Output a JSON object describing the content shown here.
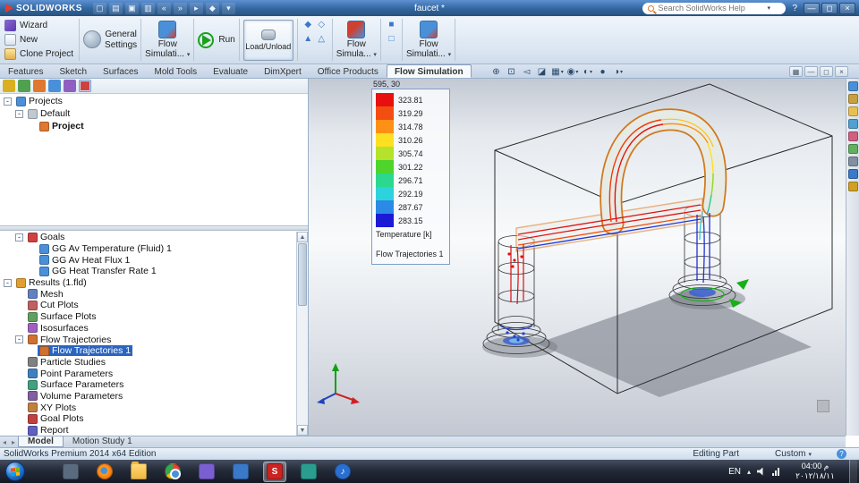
{
  "titlebar": {
    "app": "SOLIDWORKS",
    "doc": "faucet *",
    "search_placeholder": "Search SolidWorks Help",
    "help": "?",
    "quick_icons": [
      {
        "name": "new-file-icon",
        "glyph": "▢"
      },
      {
        "name": "open-file-icon",
        "glyph": "▤"
      },
      {
        "name": "save-icon",
        "glyph": "▣"
      },
      {
        "name": "print-icon",
        "glyph": "▥"
      },
      {
        "name": "undo-icon",
        "glyph": "«"
      },
      {
        "name": "redo-icon",
        "glyph": "»"
      },
      {
        "name": "select-icon",
        "glyph": "▸"
      },
      {
        "name": "rebuild-icon",
        "glyph": "◆"
      },
      {
        "name": "options-icon",
        "glyph": "▾"
      }
    ],
    "window_buttons": [
      {
        "name": "minimize-button",
        "glyph": "—"
      },
      {
        "name": "restore-button",
        "glyph": "◻"
      },
      {
        "name": "close-button",
        "glyph": "×",
        "close": true
      }
    ]
  },
  "ribbon": {
    "wizard": "Wizard",
    "new": "New",
    "clone_project": "Clone Project",
    "general_settings_1": "General",
    "general_settings_2": "Settings",
    "flow_btn1_1": "Flow",
    "flow_btn1_2": "Simulati...",
    "run": "Run",
    "load_unload": "Load/Unload",
    "flow_btn2_1": "Flow",
    "flow_btn2_2": "Simula...",
    "flow_btn3_1": "Flow",
    "flow_btn3_2": "Simulati...",
    "caret": "▾",
    "display_toggle_icons": [
      {
        "name": "flow-toggle-icon-1",
        "glyph": "◆"
      },
      {
        "name": "flow-toggle-icon-2",
        "glyph": "◇"
      },
      {
        "name": "flow-toggle-icon-3",
        "glyph": "▲"
      },
      {
        "name": "flow-toggle-icon-4",
        "glyph": "△"
      }
    ],
    "extra_toggle_icons": [
      {
        "name": "flow-toggle-icon-5",
        "glyph": "■"
      },
      {
        "name": "flow-toggle-icon-6",
        "glyph": "□"
      }
    ]
  },
  "tabs": {
    "items": [
      {
        "label": "Features"
      },
      {
        "label": "Sketch"
      },
      {
        "label": "Surfaces"
      },
      {
        "label": "Mold Tools"
      },
      {
        "label": "Evaluate"
      },
      {
        "label": "DimXpert"
      },
      {
        "label": "Office Products"
      },
      {
        "label": "Flow Simulation",
        "active": true
      }
    ]
  },
  "hud": {
    "items": [
      {
        "name": "zoom-to-fit-icon",
        "glyph": "⊕"
      },
      {
        "name": "zoom-area-icon",
        "glyph": "⊡"
      },
      {
        "name": "previous-view-icon",
        "glyph": "◅"
      },
      {
        "name": "section-view-icon",
        "glyph": "◪"
      },
      {
        "name": "view-orientation-icon",
        "glyph": "▦",
        "caret": "▾"
      },
      {
        "name": "display-style-icon",
        "glyph": "◉",
        "caret": "▾"
      },
      {
        "name": "hide-show-items-icon",
        "glyph": "◐",
        "caret": "▾"
      },
      {
        "name": "edit-appearance-icon",
        "glyph": "●"
      },
      {
        "name": "view-settings-icon",
        "glyph": "◑",
        "caret": "▾"
      }
    ]
  },
  "doc_controls": [
    {
      "name": "viewport-split-button",
      "glyph": "▦"
    },
    {
      "name": "doc-minimize-button",
      "glyph": "—"
    },
    {
      "name": "doc-restore-button",
      "glyph": "◻"
    },
    {
      "name": "doc-close-button",
      "glyph": "×"
    }
  ],
  "panel_tabs": {
    "items": [
      {
        "name": "featuremanager-tab-icon",
        "color": "#d8b020"
      },
      {
        "name": "propertymanager-tab-icon",
        "color": "#50a050"
      },
      {
        "name": "configurationmanager-tab-icon",
        "color": "#e07830"
      },
      {
        "name": "dimxpertmanager-tab-icon",
        "color": "#4a90d9"
      },
      {
        "name": "displaymanager-tab-icon",
        "color": "#9060c0"
      },
      {
        "name": "flow-simulation-tree-tab-icon",
        "color": "#d04040",
        "active": true
      }
    ]
  },
  "feature_tree": {
    "items": [
      {
        "label": "Projects",
        "level": 0,
        "exp": "-",
        "icon_color": "#4a90d9"
      },
      {
        "label": "Default",
        "level": 1,
        "exp": "-",
        "icon_color": "#c0c8d0"
      },
      {
        "label": "Project",
        "level": 2,
        "bold": true,
        "icon_color": "#e07830"
      }
    ]
  },
  "sim_tree": {
    "items": [
      {
        "label": "Goals",
        "level": 1,
        "exp": "-",
        "icon_color": "#d04040"
      },
      {
        "label": "GG Av Temperature (Fluid) 1",
        "level": 2,
        "icon_color": "#4a90d9"
      },
      {
        "label": "GG Av Heat Flux 1",
        "level": 2,
        "icon_color": "#4a90d9"
      },
      {
        "label": "GG Heat Transfer Rate 1",
        "level": 2,
        "icon_color": "#4a90d9"
      },
      {
        "label": "Results (1.fld)",
        "level": 0,
        "exp": "-",
        "icon_color": "#e0a030"
      },
      {
        "label": "Mesh",
        "level": 1,
        "icon_color": "#6080c0"
      },
      {
        "label": "Cut Plots",
        "level": 1,
        "icon_color": "#c06060"
      },
      {
        "label": "Surface Plots",
        "level": 1,
        "icon_color": "#60a060"
      },
      {
        "label": "Isosurfaces",
        "level": 1,
        "icon_color": "#a060c0"
      },
      {
        "label": "Flow Trajectories",
        "level": 1,
        "exp": "-",
        "icon_color": "#d07030"
      },
      {
        "label": "Flow Trajectories 1",
        "level": 2,
        "selected": true,
        "icon_color": "#d07030"
      },
      {
        "label": "Particle Studies",
        "level": 1,
        "icon_color": "#808080"
      },
      {
        "label": "Point Parameters",
        "level": 1,
        "icon_color": "#4080c0"
      },
      {
        "label": "Surface Parameters",
        "level": 1,
        "icon_color": "#40a080"
      },
      {
        "label": "Volume Parameters",
        "level": 1,
        "icon_color": "#8060a0"
      },
      {
        "label": "XY Plots",
        "level": 1,
        "icon_color": "#c08040"
      },
      {
        "label": "Goal Plots",
        "level": 1,
        "icon_color": "#c04040"
      },
      {
        "label": "Report",
        "level": 1,
        "icon_color": "#6060c0"
      }
    ]
  },
  "legend": {
    "coord": "595, 30",
    "rows": [
      {
        "value": "323.81",
        "color": "#e8100e"
      },
      {
        "value": "319.29",
        "color": "#f44d11"
      },
      {
        "value": "314.78",
        "color": "#ff9016"
      },
      {
        "value": "310.26",
        "color": "#fde022"
      },
      {
        "value": "305.74",
        "color": "#b5e22b"
      },
      {
        "value": "301.22",
        "color": "#4fd42c"
      },
      {
        "value": "296.71",
        "color": "#2ad88e"
      },
      {
        "value": "292.19",
        "color": "#2cd3dc"
      },
      {
        "value": "287.67",
        "color": "#2b8ae6"
      },
      {
        "value": "283.15",
        "color": "#1b1bd6"
      }
    ],
    "unit_label": "Temperature [k]",
    "plot_label": "Flow Trajectories 1"
  },
  "task_pane": {
    "items": [
      {
        "name": "solidworks-resources-icon",
        "color": "#4a90d9"
      },
      {
        "name": "design-library-icon",
        "color": "#c8a040"
      },
      {
        "name": "file-explorer-pane-icon",
        "color": "#e8c050"
      },
      {
        "name": "view-palette-icon",
        "color": "#50a0d0"
      },
      {
        "name": "appearances-icon",
        "color": "#d06080"
      },
      {
        "name": "scenes-icon",
        "color": "#60b060"
      },
      {
        "name": "custom-properties-icon",
        "color": "#8090a0"
      },
      {
        "name": "flow-simulation-pane-icon",
        "color": "#3a78c8"
      },
      {
        "name": "help-pane-icon",
        "color": "#d0a020"
      }
    ]
  },
  "model_tabs": {
    "nav": [
      {
        "name": "tab-scroll-left-icon",
        "glyph": "◂"
      },
      {
        "name": "tab-scroll-right-icon",
        "glyph": "▸"
      }
    ],
    "items": [
      {
        "label": "Model",
        "active": true
      },
      {
        "label": "Motion Study 1"
      }
    ]
  },
  "statusbar": {
    "left": "SolidWorks Premium 2014 x64 Edition",
    "editing": "Editing Part",
    "display_state": "Custom",
    "caret": "▾",
    "help_glyph": "?"
  },
  "taskbar": {
    "lang": "EN",
    "caret": "▴",
    "time": "04:00 م",
    "date": "٢٠١٢/١٨/١١",
    "icons": [
      {
        "name": "app-window-icon",
        "color": "#5a6b80",
        "glyph": ""
      },
      {
        "name": "firefox-icon",
        "color": "",
        "glyph": ""
      },
      {
        "name": "file-explorer-icon",
        "color": "",
        "glyph": ""
      },
      {
        "name": "chrome-icon",
        "color": "",
        "glyph": ""
      },
      {
        "name": "media-player-icon",
        "color": "#7a5fd0",
        "glyph": ""
      },
      {
        "name": "app-blue-icon",
        "color": "#3a78c8",
        "glyph": ""
      },
      {
        "name": "solidworks-icon",
        "color": "#cc2222",
        "glyph": "S",
        "active": true
      },
      {
        "name": "app-teal-icon",
        "color": "#2a9d8f",
        "glyph": ""
      },
      {
        "name": "music-player-icon",
        "color": "#2a6fd0",
        "glyph": "♪"
      }
    ]
  }
}
